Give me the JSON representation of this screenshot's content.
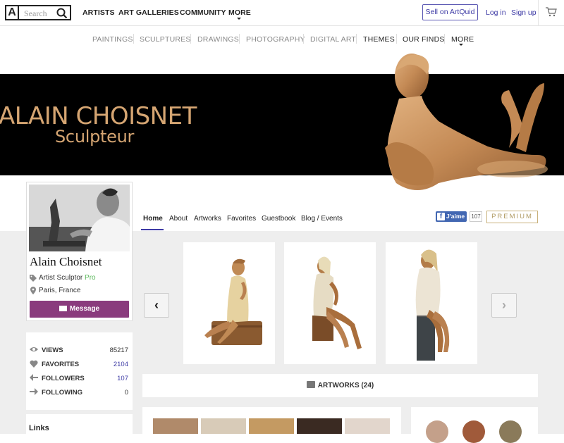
{
  "header": {
    "logo": "A",
    "search_placeholder": "Search",
    "nav": [
      "ARTISTS",
      "ART GALLERIES",
      "COMMUNITY",
      "MORE"
    ],
    "sell_label": "Sell on ArtQuid",
    "login_label": "Log in",
    "signup_label": "Sign up"
  },
  "subnav": [
    "PAINTINGS",
    "SCULPTURES",
    "DRAWINGS",
    "PHOTOGRAPHY",
    "DIGITAL ART",
    "THEMES",
    "OUR FINDS",
    "MORE"
  ],
  "banner": {
    "name": "ALAIN CHOISNET",
    "subtitle": "Sculpteur"
  },
  "profile": {
    "name": "Alain Choisnet",
    "role": "Artist Sculptor",
    "badge": "Pro",
    "location": "Paris, France",
    "message_label": "Message"
  },
  "tabs": [
    "Home",
    "About",
    "Artworks",
    "Favorites",
    "Guestbook",
    "Blog / Events"
  ],
  "facebook": {
    "label": "J'aime",
    "count": "107"
  },
  "premium_label": "PREMIUM",
  "stats": [
    {
      "label": "VIEWS",
      "value": "85217",
      "icon": "eye-icon"
    },
    {
      "label": "FAVORITES",
      "value": "2104",
      "icon": "heart-icon"
    },
    {
      "label": "FOLLOWERS",
      "value": "107",
      "icon": "arrow-left-icon"
    },
    {
      "label": "FOLLOWING",
      "value": "0",
      "icon": "arrow-right-icon"
    }
  ],
  "artworks_label": "ARTWORKS (24)",
  "links_title": "Links",
  "colors": {
    "accent": "#3d3aa5",
    "message": "#8a3b7d",
    "banner_text": "#d5a572",
    "pro": "#5cb85c"
  }
}
